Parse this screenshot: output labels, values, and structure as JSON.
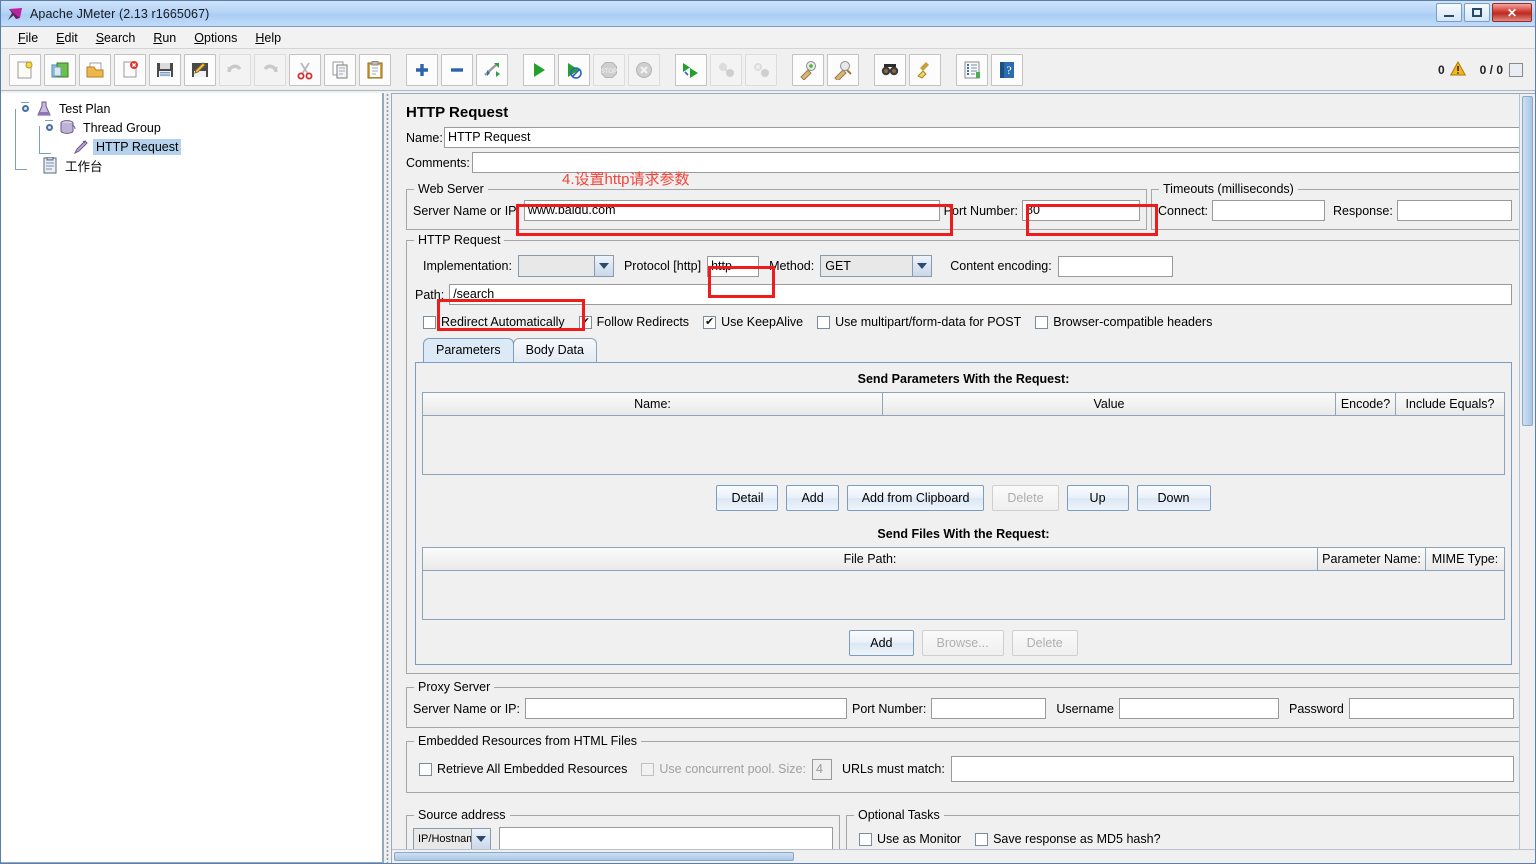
{
  "window": {
    "title": "Apache JMeter (2.13 r1665067)",
    "logo_icon": "jmeter-feather-icon",
    "minimize_label": "–",
    "maximize_label": "□",
    "close_label": "✕"
  },
  "menu": {
    "items": [
      {
        "label": "File",
        "mnemonic": "F"
      },
      {
        "label": "Edit",
        "mnemonic": "E"
      },
      {
        "label": "Search",
        "mnemonic": "S"
      },
      {
        "label": "Run",
        "mnemonic": "R"
      },
      {
        "label": "Options",
        "mnemonic": "O"
      },
      {
        "label": "Help",
        "mnemonic": "H"
      }
    ]
  },
  "toolbar": {
    "buttons": [
      {
        "name": "new-icon",
        "enabled": true
      },
      {
        "name": "templates-icon",
        "enabled": true
      },
      {
        "name": "open-icon",
        "enabled": true
      },
      {
        "name": "close-icon",
        "enabled": true
      },
      {
        "name": "save-icon",
        "enabled": true
      },
      {
        "name": "save-as-icon",
        "enabled": true
      },
      {
        "name": "undo-icon",
        "enabled": false
      },
      {
        "name": "redo-icon",
        "enabled": false
      },
      {
        "name": "cut-icon",
        "enabled": true
      },
      {
        "name": "copy-icon",
        "enabled": true
      },
      {
        "name": "paste-icon",
        "enabled": true
      },
      {
        "name": "expand-all-icon",
        "enabled": true
      },
      {
        "name": "collapse-all-icon",
        "enabled": true
      },
      {
        "name": "toggle-icon",
        "enabled": true
      },
      {
        "name": "start-icon",
        "enabled": true
      },
      {
        "name": "start-no-timers-icon",
        "enabled": true
      },
      {
        "name": "stop-icon",
        "enabled": false
      },
      {
        "name": "shutdown-icon",
        "enabled": false
      },
      {
        "name": "remote-start-all-icon",
        "enabled": true
      },
      {
        "name": "remote-stop-all-icon",
        "enabled": false
      },
      {
        "name": "remote-shutdown-all-icon",
        "enabled": false
      },
      {
        "name": "clear-icon",
        "enabled": true
      },
      {
        "name": "clear-all-icon",
        "enabled": true
      },
      {
        "name": "search-icon",
        "enabled": true
      },
      {
        "name": "search-reset-icon",
        "enabled": true
      },
      {
        "name": "function-helper-icon",
        "enabled": true
      },
      {
        "name": "help-icon",
        "enabled": true
      }
    ],
    "warning_count": "0",
    "warning_icon": "warning-triangle-icon",
    "thread_counter": "0 / 0"
  },
  "tree": {
    "nodes": [
      {
        "label": "Test Plan",
        "icon": "test-plan-icon",
        "selected": false
      },
      {
        "label": "Thread Group",
        "icon": "thread-group-icon",
        "selected": false
      },
      {
        "label": "HTTP Request",
        "icon": "http-request-icon",
        "selected": true
      },
      {
        "label": "工作台",
        "icon": "workbench-icon",
        "selected": false
      }
    ]
  },
  "main": {
    "panel_title": "HTTP Request",
    "name_label": "Name:",
    "name_value": "HTTP Request",
    "comments_label": "Comments:",
    "comments_value": "",
    "annotation": "4.设置http请求参数",
    "annotation_color": "#f0453a",
    "highlight_color": "#ee1c1c",
    "web_server": {
      "title": "Web Server",
      "server_name_label": "Server Name or IP:",
      "server_name_value": "www.baidu.com",
      "port_label": "Port Number:",
      "port_value": "80"
    },
    "timeouts": {
      "title": "Timeouts (milliseconds)",
      "connect_label": "Connect:",
      "connect_value": "",
      "response_label": "Response:",
      "response_value": ""
    },
    "http_request": {
      "title": "HTTP Request",
      "implementation_label": "Implementation:",
      "implementation_value": "",
      "protocol_label": "Protocol [http]",
      "protocol_value": "http",
      "method_label": "Method:",
      "method_value": "GET",
      "content_encoding_label": "Content encoding:",
      "content_encoding_value": "",
      "path_label": "Path:",
      "path_value": "/search",
      "checkboxes": [
        {
          "label": "Redirect Automatically",
          "checked": false
        },
        {
          "label": "Follow Redirects",
          "checked": true
        },
        {
          "label": "Use KeepAlive",
          "checked": true
        },
        {
          "label": "Use multipart/form-data for POST",
          "checked": false
        },
        {
          "label": "Browser-compatible headers",
          "checked": false
        }
      ]
    },
    "tabs": [
      {
        "label": "Parameters",
        "active": true
      },
      {
        "label": "Body Data",
        "active": false
      }
    ],
    "parameters": {
      "caption": "Send Parameters With the Request:",
      "columns": [
        "Name:",
        "Value",
        "Encode?",
        "Include Equals?"
      ],
      "rows": [],
      "buttons": [
        {
          "label": "Detail",
          "enabled": true
        },
        {
          "label": "Add",
          "enabled": true
        },
        {
          "label": "Add from Clipboard",
          "enabled": true
        },
        {
          "label": "Delete",
          "enabled": false
        },
        {
          "label": "Up",
          "enabled": true
        },
        {
          "label": "Down",
          "enabled": true
        }
      ]
    },
    "files": {
      "caption": "Send Files With the Request:",
      "columns": [
        "File Path:",
        "Parameter Name:",
        "MIME Type:"
      ],
      "rows": [],
      "buttons": [
        {
          "label": "Add",
          "enabled": true
        },
        {
          "label": "Browse...",
          "enabled": false
        },
        {
          "label": "Delete",
          "enabled": false
        }
      ]
    },
    "proxy": {
      "title": "Proxy Server",
      "server_name_label": "Server Name or IP:",
      "server_name_value": "",
      "port_label": "Port Number:",
      "port_value": "",
      "username_label": "Username",
      "username_value": "",
      "password_label": "Password",
      "password_value": ""
    },
    "embedded": {
      "title": "Embedded Resources from HTML Files",
      "retrieve_label": "Retrieve All Embedded Resources",
      "retrieve_checked": false,
      "pool_label": "Use concurrent pool. Size:",
      "pool_checked": false,
      "pool_size": "4",
      "urls_label": "URLs must match:",
      "urls_value": ""
    },
    "source_address": {
      "title": "Source address",
      "type_value": "IP/Hostname",
      "value": ""
    },
    "optional_tasks": {
      "title": "Optional Tasks",
      "monitor_label": "Use as Monitor",
      "monitor_checked": false,
      "md5_label": "Save response as MD5 hash?",
      "md5_checked": false
    }
  }
}
